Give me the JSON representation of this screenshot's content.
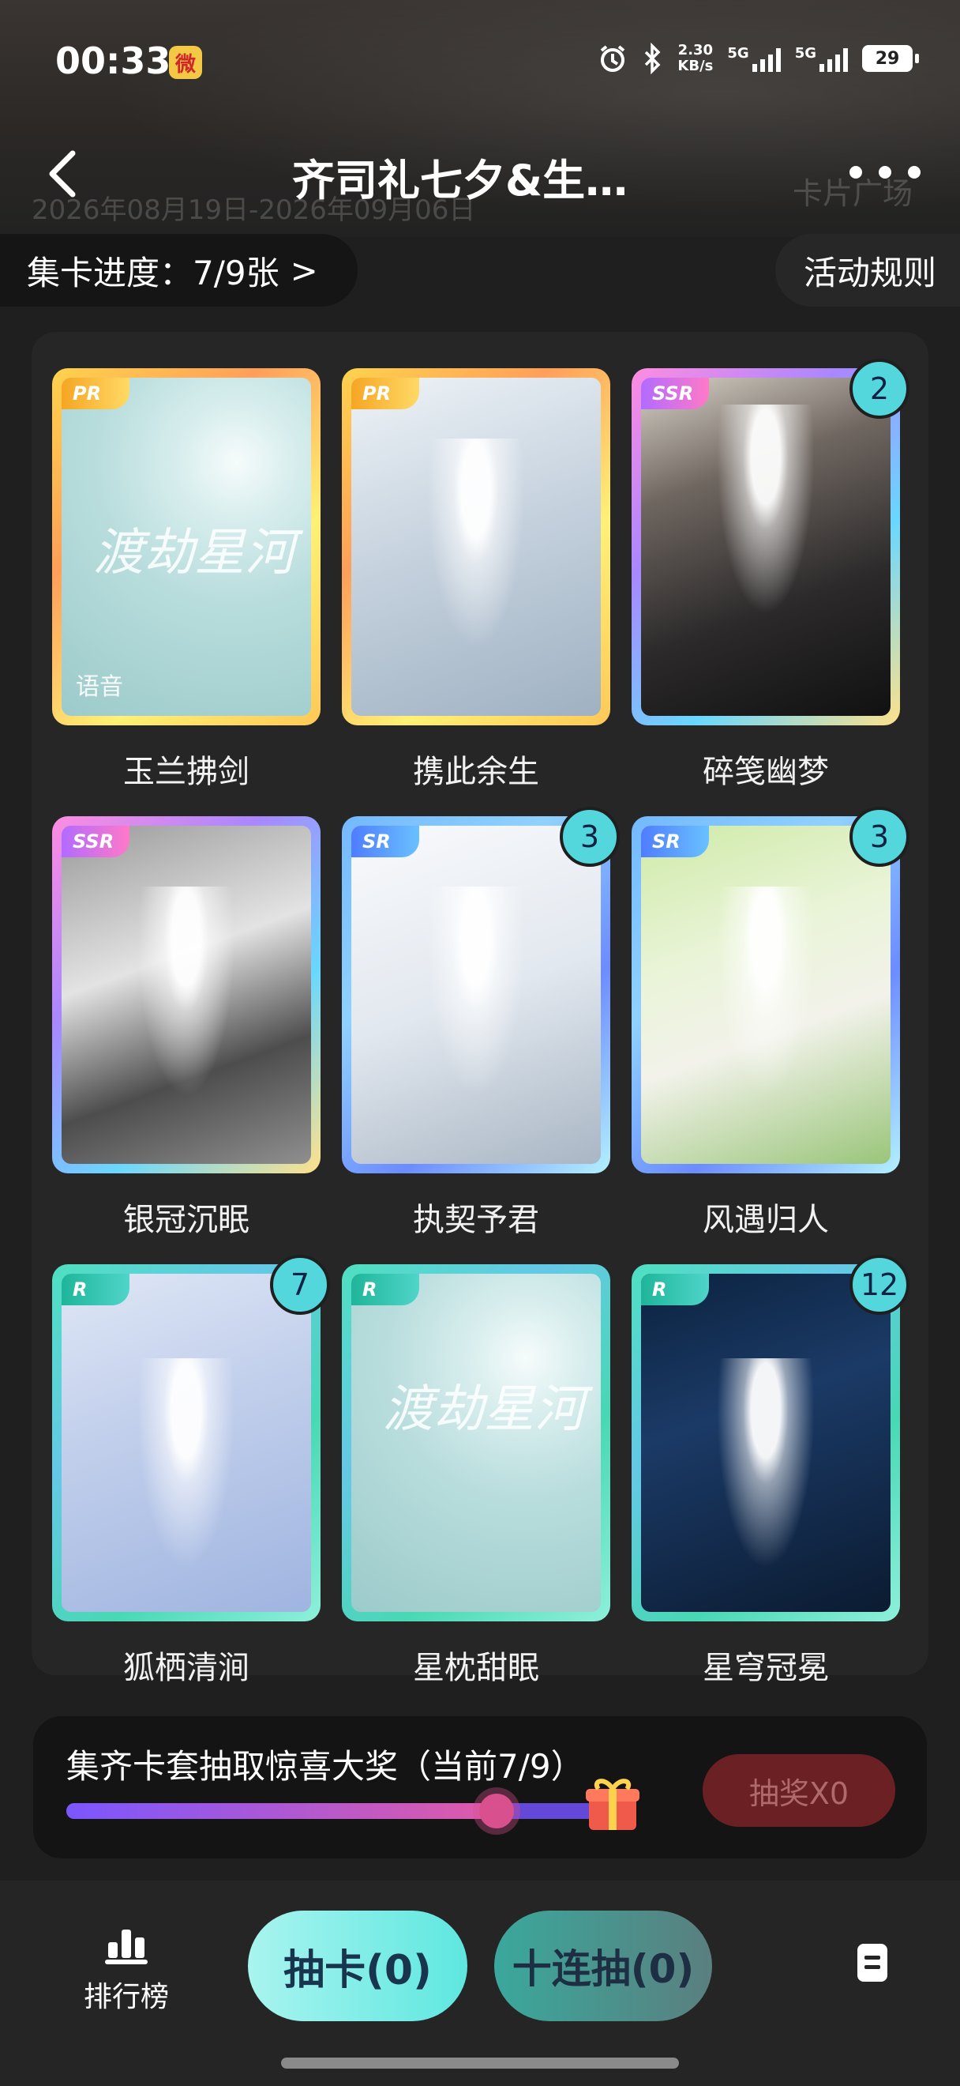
{
  "status": {
    "time": "00:33",
    "app_badge": "微",
    "net_speed_value": "2.30",
    "net_speed_unit": "KB/s",
    "sig1_label": "5G",
    "sig2_label": "5G",
    "battery": "29"
  },
  "header": {
    "title": "齐司礼七夕&生…",
    "date_range": "2026年08月19日-2026年09月06日",
    "card_square": "卡片广场"
  },
  "progress": {
    "label": "集卡进度：7/9张",
    "chevron": ">"
  },
  "rules_label": "活动规则",
  "cards": [
    {
      "name": "玉兰拂剑",
      "rarity": "PR",
      "count": "",
      "overlay_text": "语音",
      "calligraphy": "渡劫星河"
    },
    {
      "name": "携此余生",
      "rarity": "PR",
      "count": "",
      "overlay_text": "",
      "calligraphy": ""
    },
    {
      "name": "碎笺幽梦",
      "rarity": "SSR",
      "count": "2",
      "overlay_text": "",
      "calligraphy": ""
    },
    {
      "name": "银冠沉眠",
      "rarity": "SSR",
      "count": "",
      "overlay_text": "",
      "calligraphy": ""
    },
    {
      "name": "执契予君",
      "rarity": "SR",
      "count": "3",
      "overlay_text": "",
      "calligraphy": ""
    },
    {
      "name": "风遇归人",
      "rarity": "SR",
      "count": "3",
      "overlay_text": "",
      "calligraphy": ""
    },
    {
      "name": "狐栖清涧",
      "rarity": "R",
      "count": "7",
      "overlay_text": "",
      "calligraphy": ""
    },
    {
      "name": "星枕甜眠",
      "rarity": "R",
      "count": "",
      "overlay_text": "",
      "calligraphy": "渡劫星河"
    },
    {
      "name": "星穹冠冕",
      "rarity": "R",
      "count": "12",
      "overlay_text": "",
      "calligraphy": ""
    }
  ],
  "lottery": {
    "text": "集齐卡套抽取惊喜大奖（当前7/9）",
    "progress": 0.778,
    "button": "抽奖X0"
  },
  "bottom": {
    "rank_label": "排行榜",
    "draw_one": "抽卡(0)",
    "draw_ten": "十连抽(0)"
  }
}
